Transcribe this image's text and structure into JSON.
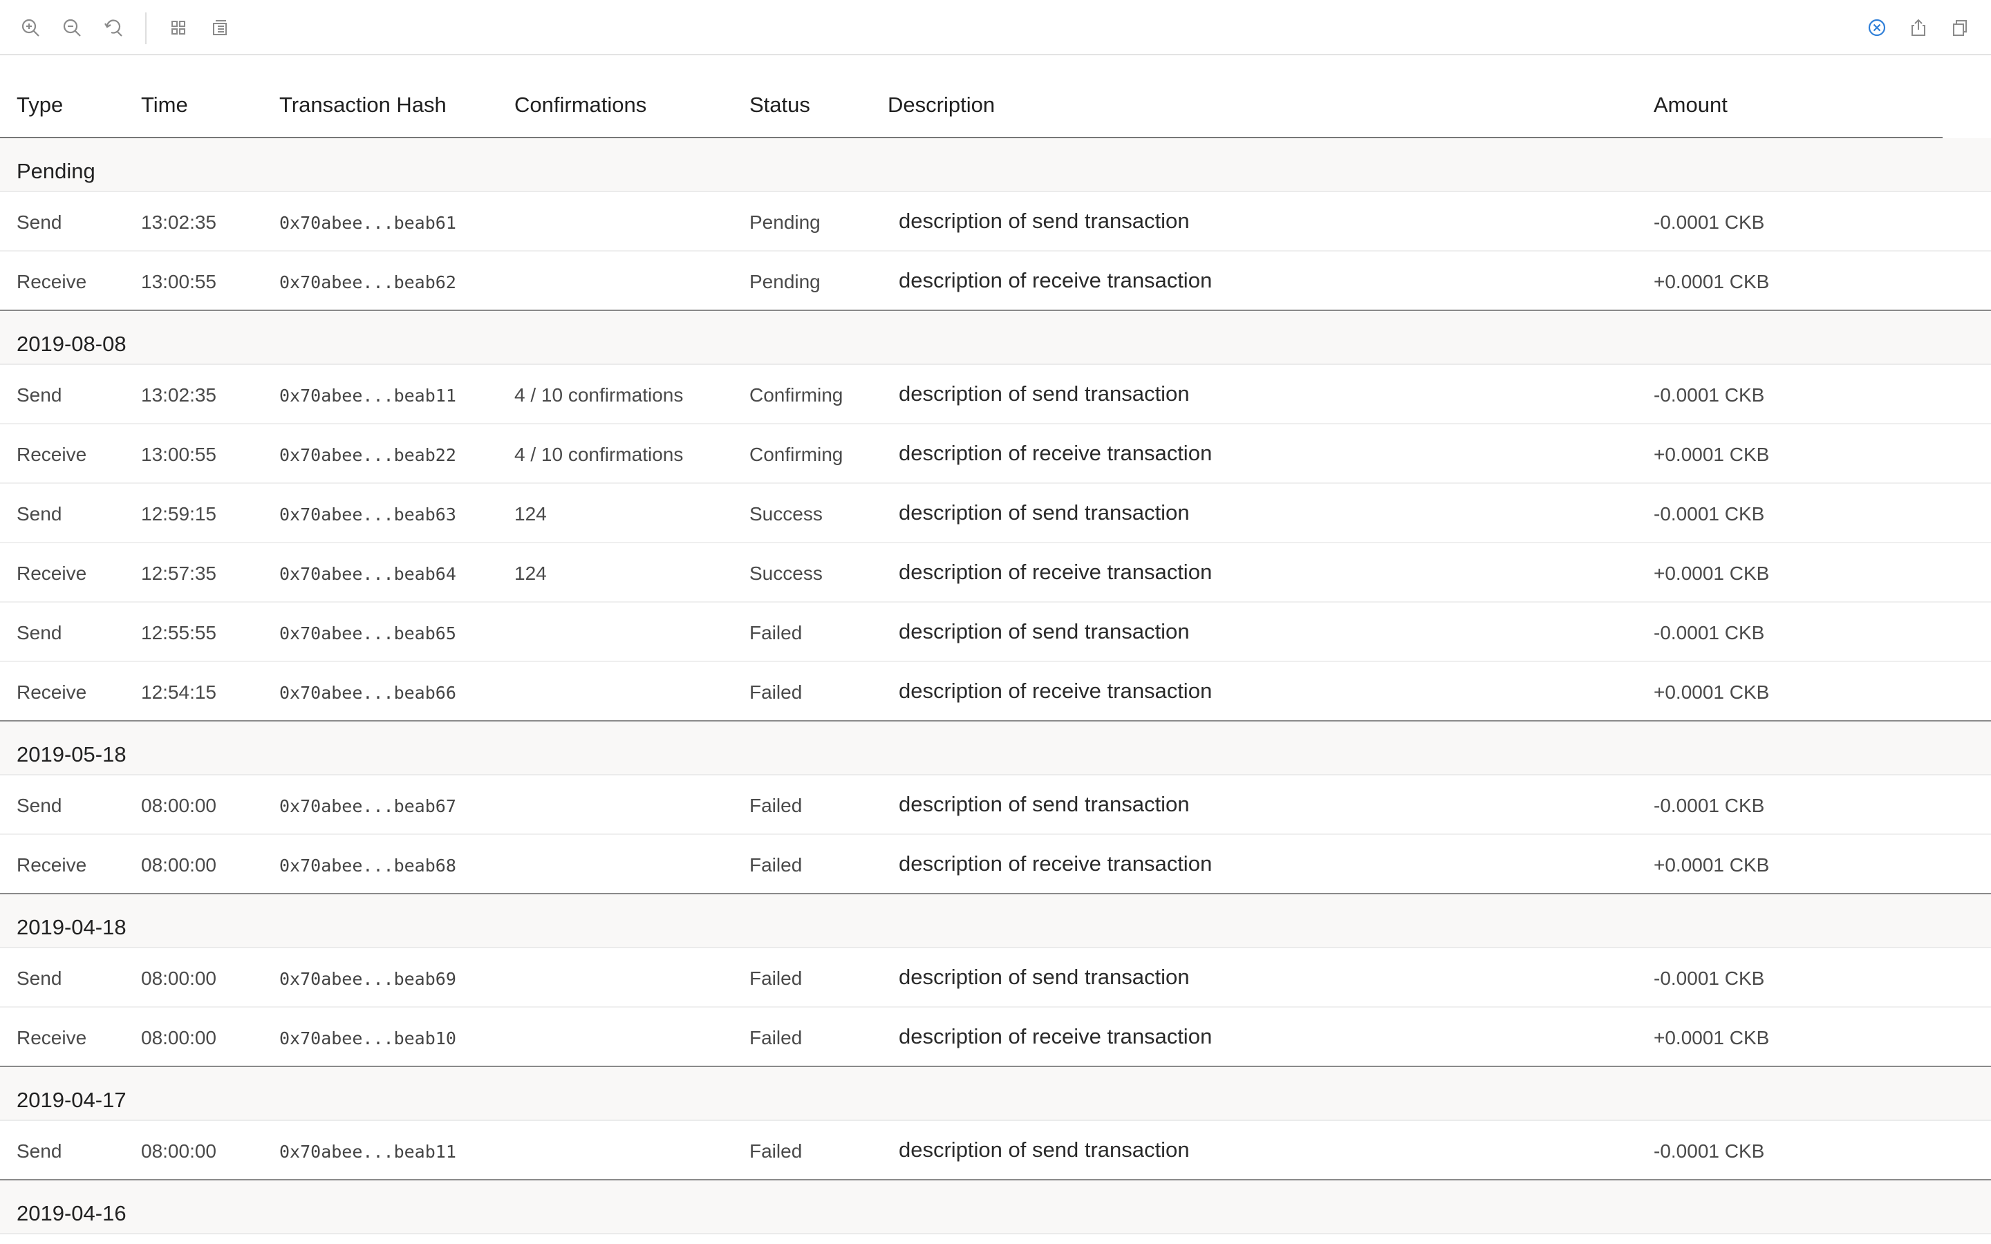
{
  "colors": {
    "accent": "#2f7fd8",
    "text": "#333333",
    "group_bg": "#f9f8f7"
  },
  "toolbar": {
    "left_icons": [
      "zoom-in-icon",
      "zoom-out-icon",
      "refresh-icon",
      "grid-icon",
      "layout-icon"
    ],
    "right_icons": [
      "close-circle-icon",
      "share-icon",
      "copy-icon"
    ]
  },
  "table": {
    "columns": [
      "Type",
      "Time",
      "Transaction Hash",
      "Confirmations",
      "Status",
      "Description",
      "Amount"
    ],
    "groups": [
      {
        "label": "Pending",
        "rows": [
          {
            "type": "Send",
            "time": "13:02:35",
            "hash": "0x70abee...beab61",
            "confirmations": "",
            "status": "Pending",
            "description": "description of send transaction",
            "amount": "-0.0001 CKB"
          },
          {
            "type": "Receive",
            "time": "13:00:55",
            "hash": "0x70abee...beab62",
            "confirmations": "",
            "status": "Pending",
            "description": "description of receive transaction",
            "amount": "+0.0001 CKB"
          }
        ]
      },
      {
        "label": "2019-08-08",
        "rows": [
          {
            "type": "Send",
            "time": "13:02:35",
            "hash": "0x70abee...beab11",
            "confirmations": "4 / 10 confirmations",
            "status": "Confirming",
            "description": "description of send transaction",
            "amount": "-0.0001 CKB"
          },
          {
            "type": "Receive",
            "time": "13:00:55",
            "hash": "0x70abee...beab22",
            "confirmations": "4 / 10 confirmations",
            "status": "Confirming",
            "description": "description of receive transaction",
            "amount": "+0.0001 CKB"
          },
          {
            "type": "Send",
            "time": "12:59:15",
            "hash": "0x70abee...beab63",
            "confirmations": "124",
            "status": "Success",
            "description": "description of send transaction",
            "amount": "-0.0001 CKB"
          },
          {
            "type": "Receive",
            "time": "12:57:35",
            "hash": "0x70abee...beab64",
            "confirmations": "124",
            "status": "Success",
            "description": "description of receive transaction",
            "amount": "+0.0001 CKB"
          },
          {
            "type": "Send",
            "time": "12:55:55",
            "hash": "0x70abee...beab65",
            "confirmations": "",
            "status": "Failed",
            "description": "description of send transaction",
            "amount": "-0.0001 CKB"
          },
          {
            "type": "Receive",
            "time": "12:54:15",
            "hash": "0x70abee...beab66",
            "confirmations": "",
            "status": "Failed",
            "description": "description of receive transaction",
            "amount": "+0.0001 CKB"
          }
        ]
      },
      {
        "label": "2019-05-18",
        "rows": [
          {
            "type": "Send",
            "time": "08:00:00",
            "hash": "0x70abee...beab67",
            "confirmations": "",
            "status": "Failed",
            "description": "description of send transaction",
            "amount": "-0.0001 CKB"
          },
          {
            "type": "Receive",
            "time": "08:00:00",
            "hash": "0x70abee...beab68",
            "confirmations": "",
            "status": "Failed",
            "description": "description of receive transaction",
            "amount": "+0.0001 CKB"
          }
        ]
      },
      {
        "label": "2019-04-18",
        "rows": [
          {
            "type": "Send",
            "time": "08:00:00",
            "hash": "0x70abee...beab69",
            "confirmations": "",
            "status": "Failed",
            "description": "description of send transaction",
            "amount": "-0.0001 CKB"
          },
          {
            "type": "Receive",
            "time": "08:00:00",
            "hash": "0x70abee...beab10",
            "confirmations": "",
            "status": "Failed",
            "description": "description of receive transaction",
            "amount": "+0.0001 CKB"
          }
        ]
      },
      {
        "label": "2019-04-17",
        "rows": [
          {
            "type": "Send",
            "time": "08:00:00",
            "hash": "0x70abee...beab11",
            "confirmations": "",
            "status": "Failed",
            "description": "description of send transaction",
            "amount": "-0.0001 CKB"
          }
        ]
      },
      {
        "label": "2019-04-16",
        "rows": []
      }
    ]
  }
}
